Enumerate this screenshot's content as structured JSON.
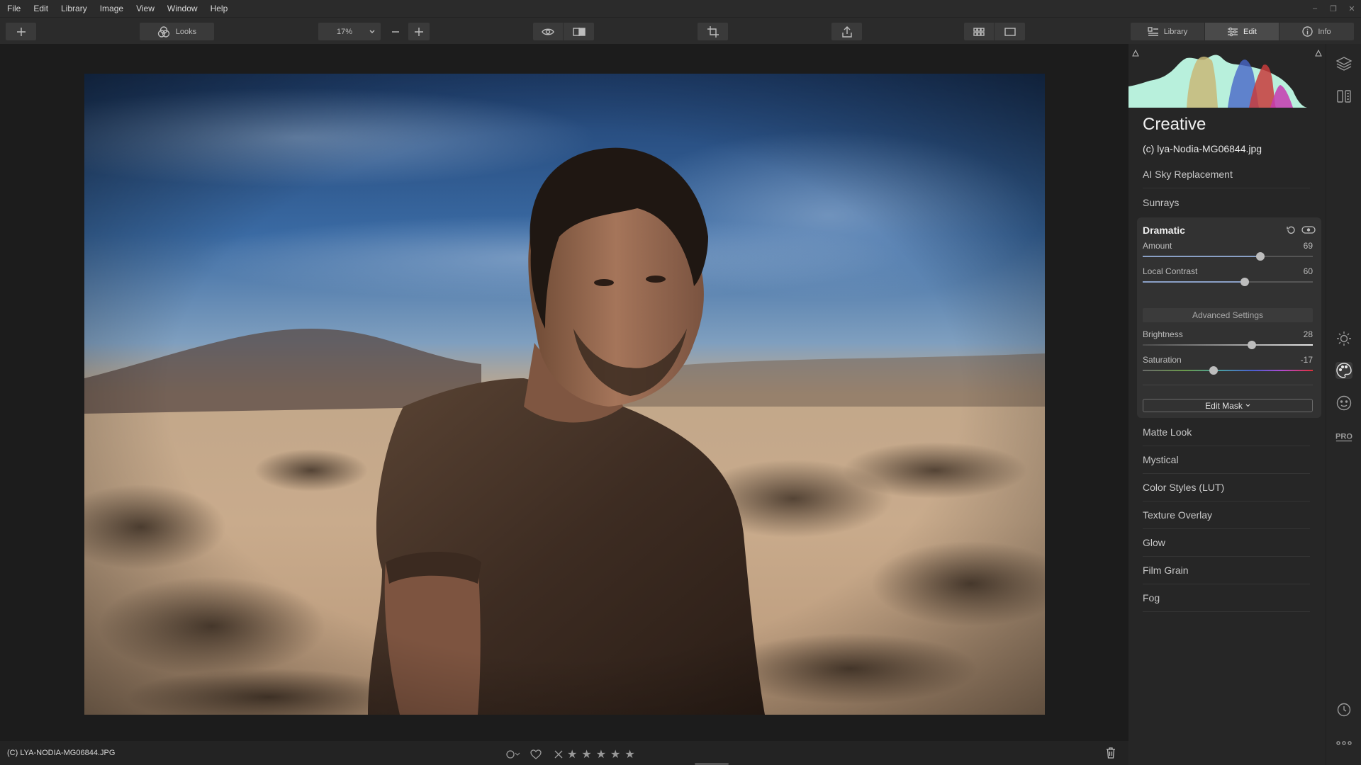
{
  "menu": [
    "File",
    "Edit",
    "Library",
    "Image",
    "View",
    "Window",
    "Help"
  ],
  "window_controls": [
    "–",
    "❐",
    "✕"
  ],
  "toolbar": {
    "looks_label": "Looks",
    "zoom_value": "17%",
    "zoom_minus": "—",
    "zoom_plus": "+",
    "tabs": [
      {
        "label": "Library",
        "icon": "library-icon"
      },
      {
        "label": "Edit",
        "icon": "sliders-icon"
      },
      {
        "label": "Info",
        "icon": "info-icon"
      }
    ],
    "active_tab": "Edit"
  },
  "status": {
    "filename": "(C) LYA-NODIA-MG06844.JPG"
  },
  "panel": {
    "title": "Creative",
    "subtitle": "(c) lya-Nodia-MG06844.jpg",
    "sections_top": [
      "AI Sky Replacement",
      "Sunrays"
    ],
    "tool": {
      "title": "Dramatic",
      "sliders": [
        {
          "label": "Amount",
          "value": "69",
          "fraction": 0.69,
          "color": "#8aa0c6"
        },
        {
          "label": "Local Contrast",
          "value": "60",
          "fraction": 0.6,
          "color": "#8aa0c6"
        }
      ],
      "advanced_label": "Advanced Settings",
      "advanced_sliders": [
        {
          "label": "Brightness",
          "value": "28",
          "fraction": 0.64,
          "kind": "brightness"
        },
        {
          "label": "Saturation",
          "value": "-17",
          "fraction": 0.415,
          "kind": "saturation"
        }
      ],
      "edit_mask_label": "Edit Mask"
    },
    "sections_bottom": [
      "Matte Look",
      "Mystical",
      "Color Styles (LUT)",
      "Texture Overlay",
      "Glow",
      "Film Grain",
      "Fog"
    ]
  },
  "strip_icons": [
    "layers-icon",
    "compare-panel-icon",
    "sun-icon",
    "palette-icon",
    "face-icon",
    "pro-icon",
    "clock-icon",
    "more-icon"
  ],
  "strip_pro_label": "PRO",
  "colors": {
    "accent": "#8aa0c6",
    "panel": "#262626",
    "card": "#323232"
  }
}
